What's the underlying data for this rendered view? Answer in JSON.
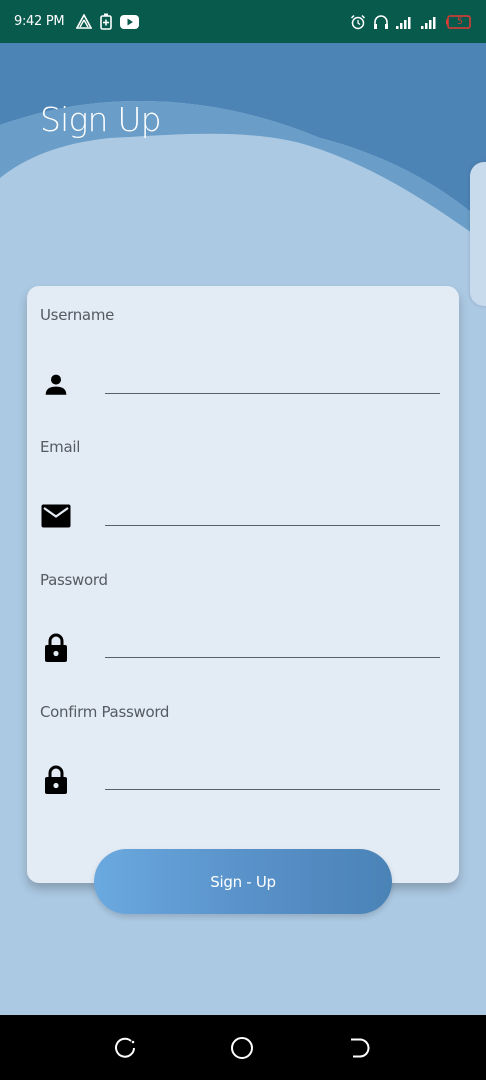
{
  "status_bar": {
    "time": "9:42 PM",
    "battery_level": "5",
    "left_icons": [
      "warning-triangle-icon",
      "battery-saver-icon",
      "youtube-icon"
    ],
    "right_icons": [
      "alarm-icon",
      "headphones-icon",
      "signal-icon",
      "signal-icon",
      "battery-icon"
    ]
  },
  "header": {
    "title": "Sign Up"
  },
  "form": {
    "fields": [
      {
        "label": "Username",
        "icon": "person-icon",
        "value": "",
        "placeholder": ""
      },
      {
        "label": "Email",
        "icon": "mail-icon",
        "value": "",
        "placeholder": ""
      },
      {
        "label": "Password",
        "icon": "lock-icon",
        "value": "",
        "placeholder": ""
      },
      {
        "label": "Confirm Password",
        "icon": "lock-icon",
        "value": "",
        "placeholder": ""
      }
    ],
    "submit_label": "Sign - Up"
  },
  "nav_bar": {
    "buttons": [
      "recent-apps-icon",
      "home-icon",
      "back-icon"
    ]
  },
  "colors": {
    "status_bar": "#075a4c",
    "background": "#acc9e3",
    "header_wave_dark": "#4d84b6",
    "card": "#e3ebf4",
    "button_start": "#6aa9df",
    "button_end": "#4a83b6"
  }
}
